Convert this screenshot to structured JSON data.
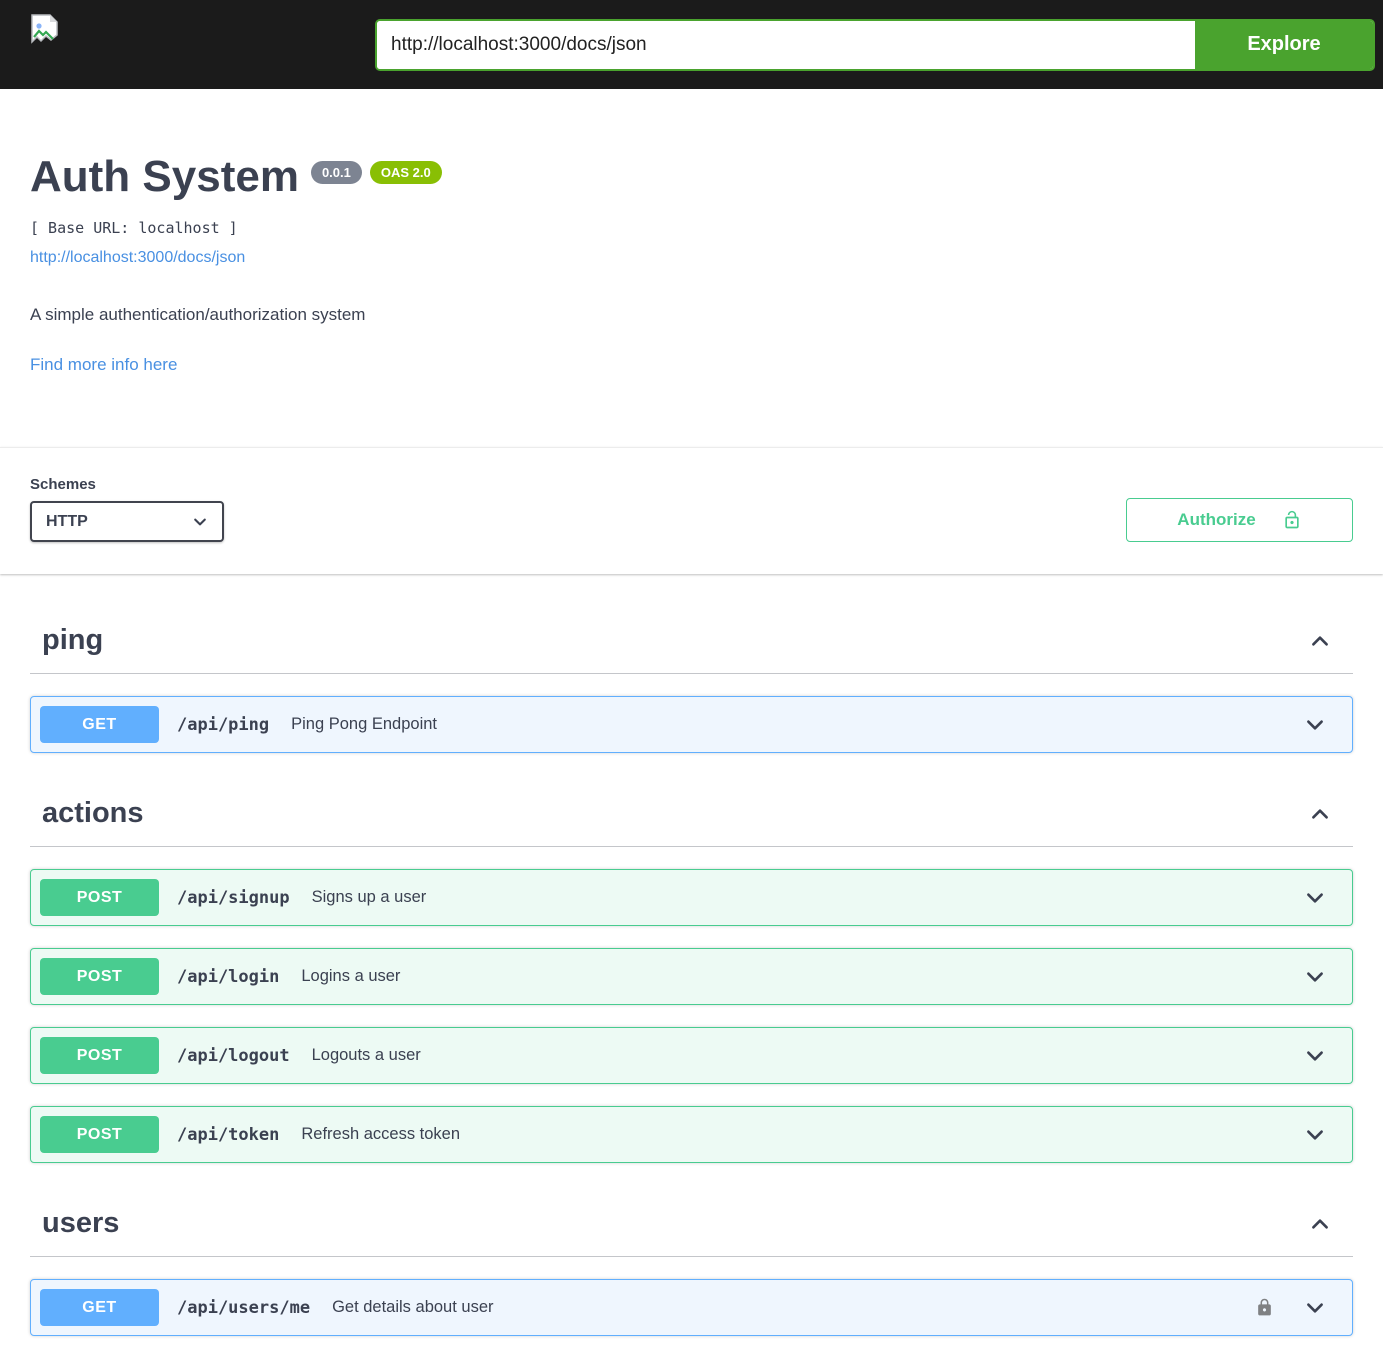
{
  "topbar": {
    "url_value": "http://localhost:3000/docs/json",
    "explore_label": "Explore"
  },
  "info": {
    "title": "Auth System",
    "version_badge": "0.0.1",
    "oas_badge": "OAS 2.0",
    "base_url": "[ Base URL: localhost ]",
    "spec_link": "http://localhost:3000/docs/json",
    "description": "A simple authentication/authorization system",
    "more_info_link": "Find more info here"
  },
  "schemes": {
    "label": "Schemes",
    "selected": "HTTP"
  },
  "auth": {
    "authorize_label": "Authorize"
  },
  "sections": [
    {
      "name": "ping",
      "operations": [
        {
          "method": "GET",
          "path": "/api/ping",
          "summary": "Ping Pong Endpoint",
          "locked": false
        }
      ]
    },
    {
      "name": "actions",
      "operations": [
        {
          "method": "POST",
          "path": "/api/signup",
          "summary": "Signs up a user",
          "locked": false
        },
        {
          "method": "POST",
          "path": "/api/login",
          "summary": "Logins a user",
          "locked": false
        },
        {
          "method": "POST",
          "path": "/api/logout",
          "summary": "Logouts a user",
          "locked": false
        },
        {
          "method": "POST",
          "path": "/api/token",
          "summary": "Refresh access token",
          "locked": false
        }
      ]
    },
    {
      "name": "users",
      "operations": [
        {
          "method": "GET",
          "path": "/api/users/me",
          "summary": "Get details about user",
          "locked": true
        }
      ]
    }
  ],
  "colors": {
    "topbar_bg": "#1b1b1b",
    "explore_green": "#4aa32e",
    "get_blue": "#61affe",
    "post_green": "#49cc90",
    "authorize_green": "#49cc90",
    "oas_badge_green": "#89bf04",
    "version_badge_gray": "#7d8492",
    "link_blue": "#4990e2",
    "text": "#3b4151"
  }
}
